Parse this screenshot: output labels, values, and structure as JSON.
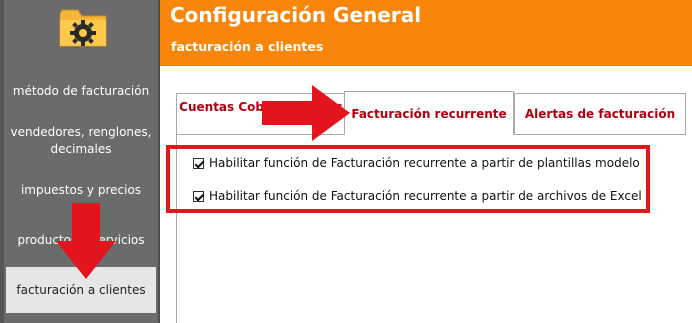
{
  "header": {
    "title": "Configuración General",
    "subtitle": "facturación a clientes",
    "color": "#f7860b"
  },
  "sidebar": {
    "logo_icon": "folder-gear-icon",
    "items": [
      {
        "label": "método de facturación"
      },
      {
        "label": "vendedores, renglones, decimales"
      },
      {
        "label": "impuestos y precios"
      },
      {
        "label": "productos y servicios"
      },
      {
        "label": "facturación a clientes",
        "active": true
      }
    ]
  },
  "tabs": [
    {
      "label": "Cuentas Cobrar Clientes"
    },
    {
      "label": "Facturación recurrente",
      "active": true
    },
    {
      "label": "Alertas de facturación"
    }
  ],
  "options": [
    {
      "label": "Habilitar función de Facturación recurrente a partir de plantillas modelo",
      "checked": true
    },
    {
      "label": "Habilitar función de Facturación recurrente a partir de archivos de Excel",
      "checked": true
    }
  ],
  "annotation_color": "#e4141e"
}
